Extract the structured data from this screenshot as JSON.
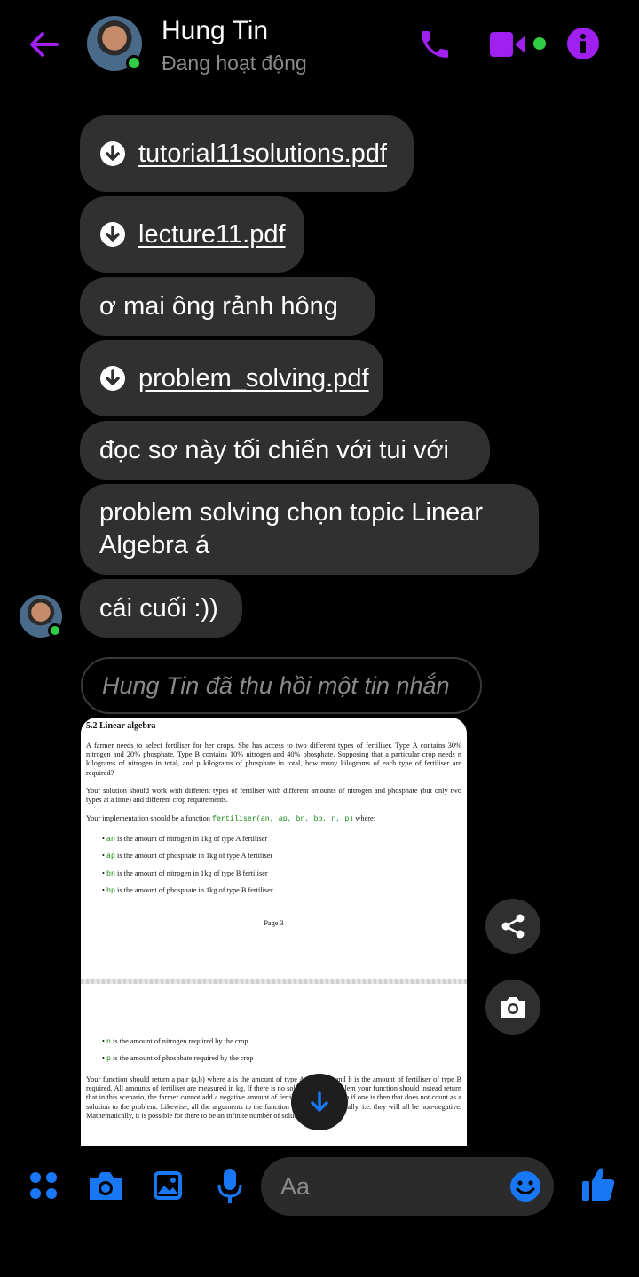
{
  "header": {
    "name": "Hung Tin",
    "status": "Đang hoạt động"
  },
  "messages": {
    "file1": "tutorial11solutions.pdf",
    "file2": "lecture11.pdf",
    "text1": "ơ mai ông rảnh hông",
    "file3": "problem_solving.pdf",
    "text2": "đọc sơ này tối chiến với tui với",
    "text3_line1": "problem solving chọn topic Linear",
    "text3_line2": "Algebra á",
    "text4": "cái cuối :))",
    "recalled": "Hung Tin đã thu hồi một tin nhắn"
  },
  "document": {
    "section": "5.2   Linear algebra",
    "p1": "A farmer needs to select fertiliser for her crops. She has access to two different types of fertiliser. Type A contains 30% nitrogen and 20% phosphate. Type B contains 10% nitrogen and 40% phosphate. Supposing that a particular crop needs n kilograms of nitrogen in total, and p kilograms of phosphate in total, how many kilograms of each type of fertiliser are required?",
    "p2": "Your solution should work with different types of fertiliser with different amounts of nitrogen and phosphate (but only two types at a time) and different crop requirements.",
    "p3_pre": "Your implementation should be a function ",
    "p3_code": "fertiliser(an, ap, bn, bp, n, p)",
    "p3_post": " where:",
    "bullets": [
      {
        "code": "an",
        "text": " is the amount of nitrogen in 1kg of type A fertiliser"
      },
      {
        "code": "ap",
        "text": " is the amount of phosphate in 1kg of type A fertiliser"
      },
      {
        "code": "bn",
        "text": " is the amount of nitrogen in 1kg of type B fertiliser"
      },
      {
        "code": "bp",
        "text": " is the amount of phosphate in 1kg of type B fertiliser"
      }
    ],
    "page": "Page 3",
    "bullets2": [
      {
        "code": "n",
        "text": " is the amount of nitrogen required by the crop"
      },
      {
        "code": "p",
        "text": " is the amount of phosphate required by the crop"
      }
    ],
    "p4": "Your function should return a pair (a,b) where a is the amount of type A required, and b is the amount of fertiliser of type B required. All amounts of fertiliser are measured in kg. If there is no solution to the problem your function should instead return that in this scenario, the farmer cannot add a negative amount of fertiliser to her field, so if one is then that does not count as a solution to the problem. Likewise, all the arguments to the function make sense physically, i.e. they will all be non-negative. Mathematically, it is possible for there to be an infinite number of solutions, but this is"
  },
  "composer": {
    "placeholder": "Aa"
  },
  "colors": {
    "accent_purple": "#a020f0",
    "accent_blue": "#1877f2",
    "online_green": "#31cc46",
    "bubble": "#303030"
  },
  "icons": [
    "back-arrow-icon",
    "phone-icon",
    "video-icon",
    "info-icon",
    "download-icon",
    "share-icon",
    "camera-icon",
    "arrow-down-icon",
    "apps-icon",
    "image-icon",
    "mic-icon",
    "emoji-icon",
    "thumbs-up-icon"
  ]
}
